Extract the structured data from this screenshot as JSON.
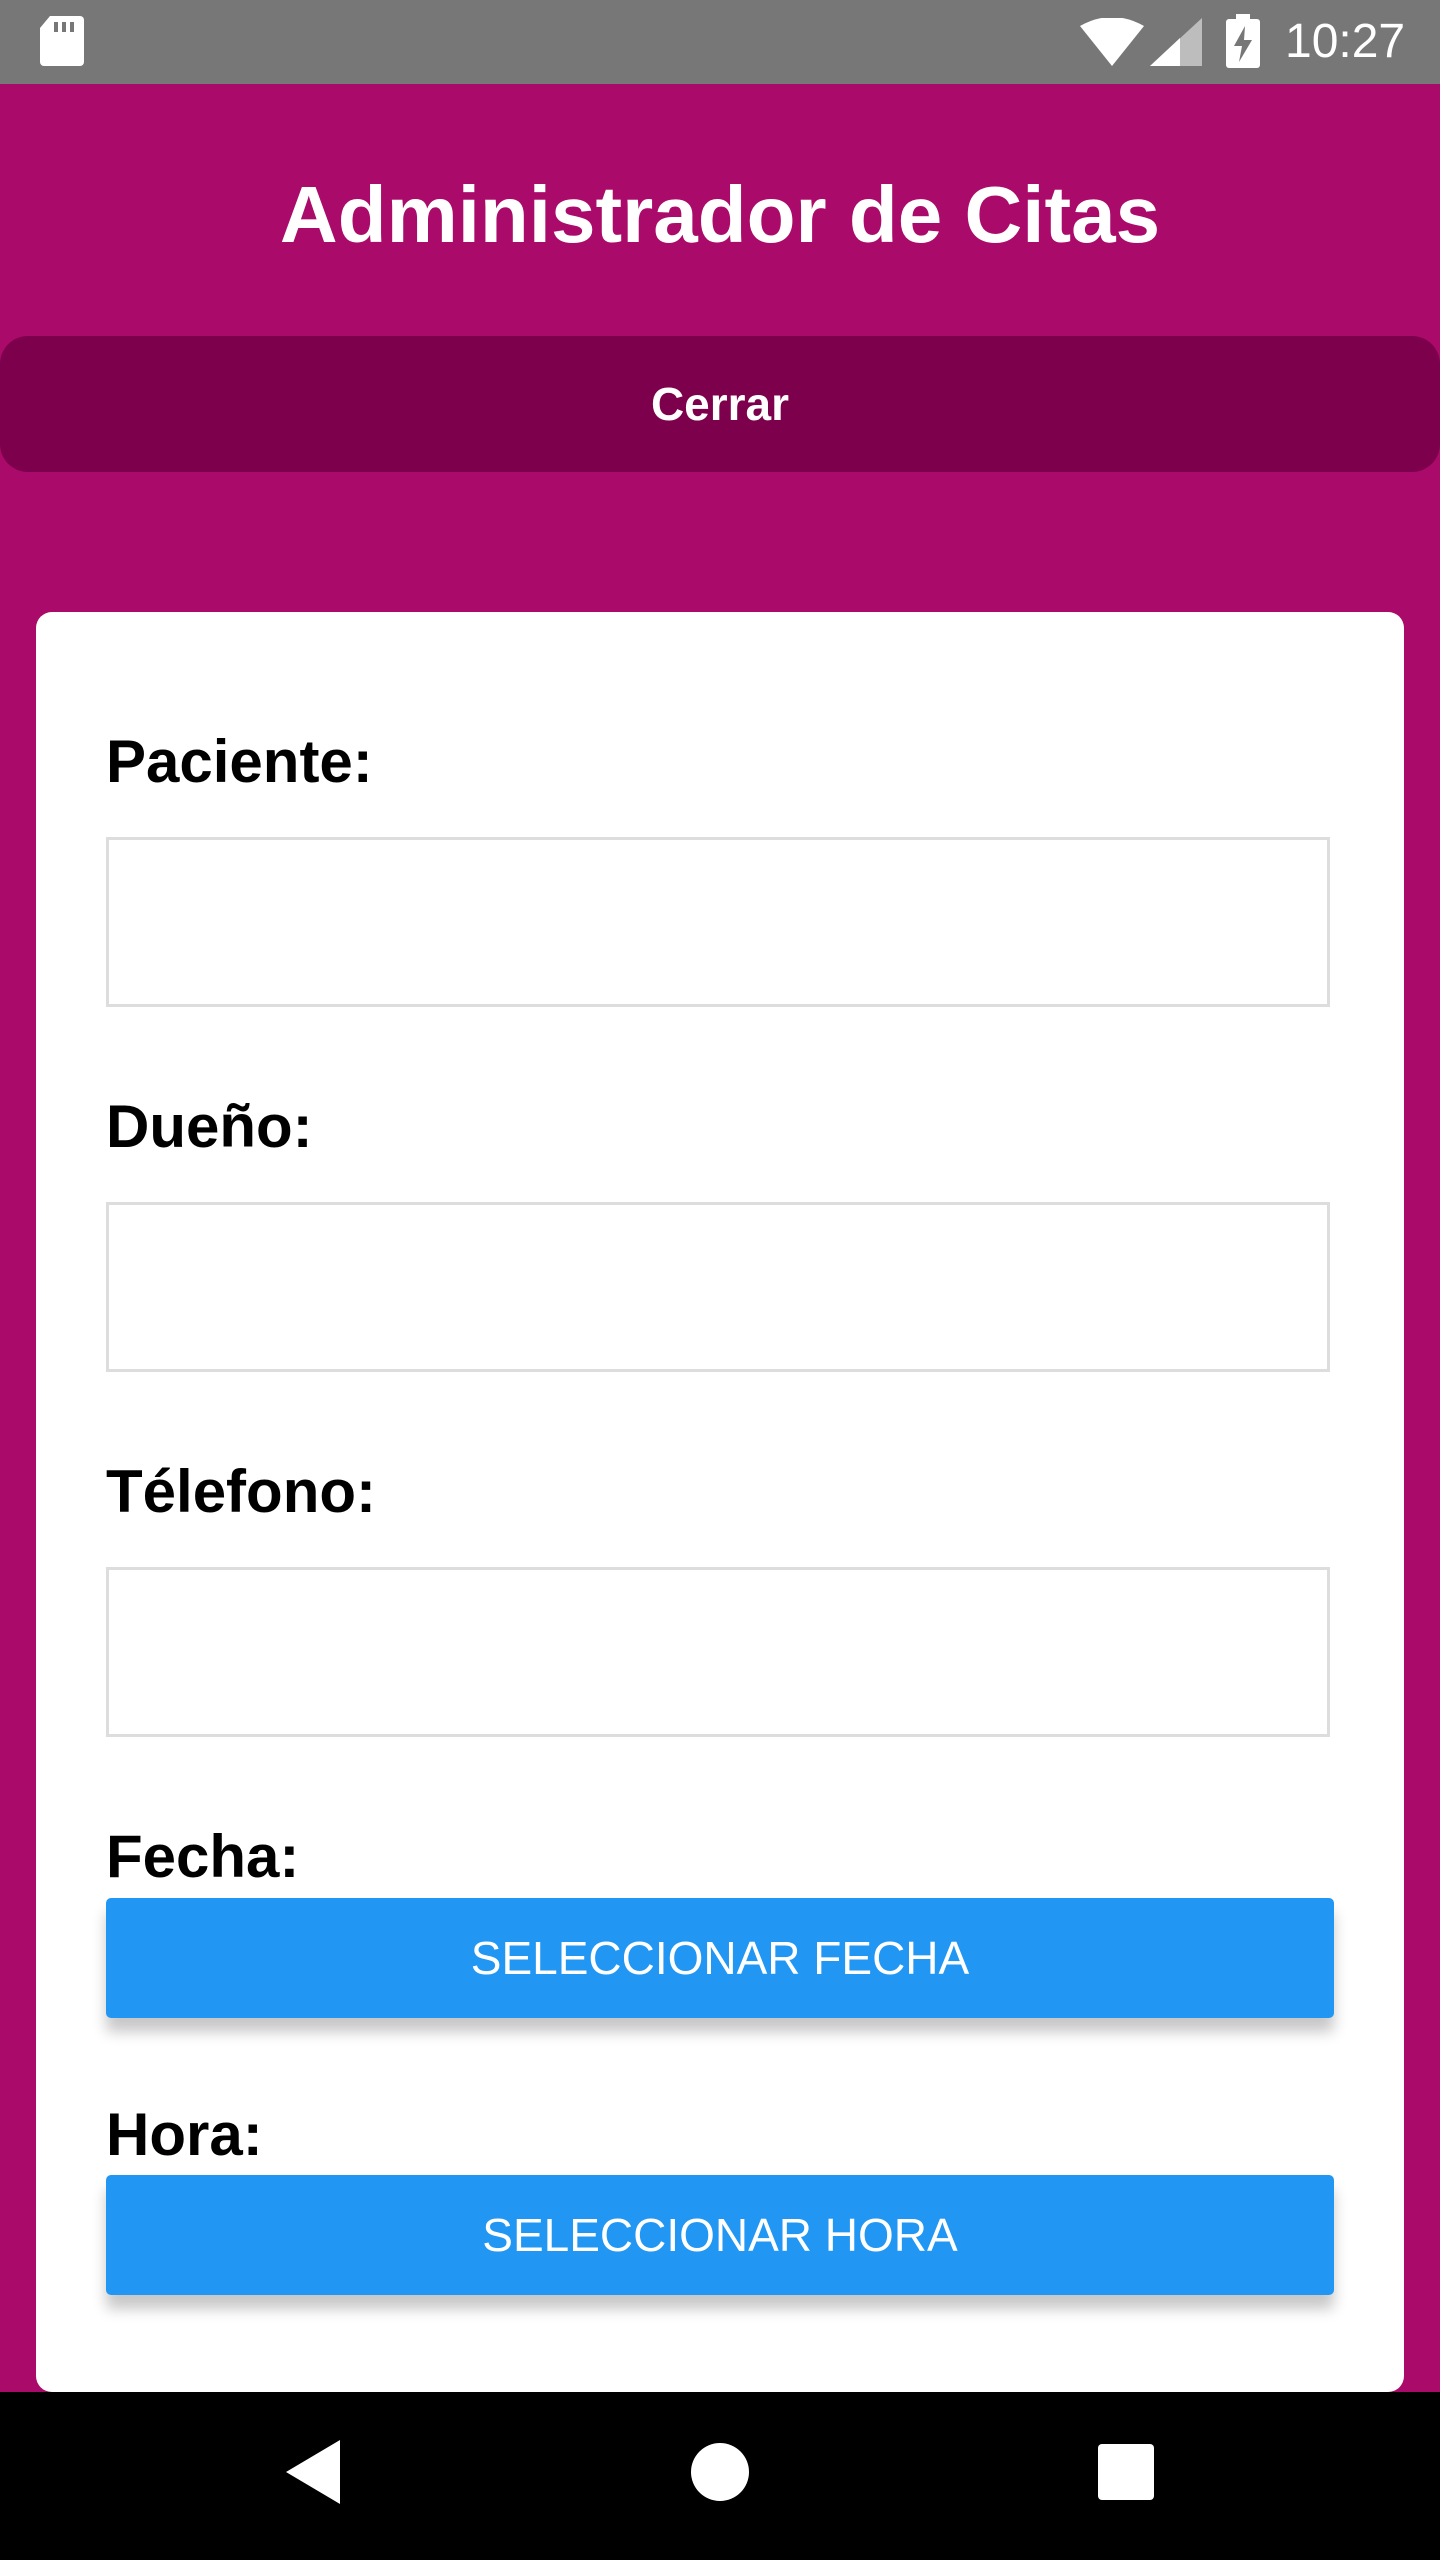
{
  "status_bar": {
    "time": "10:27",
    "icons": [
      "sd-card-icon",
      "wifi-icon",
      "signal-icon",
      "battery-charging-icon"
    ],
    "background": "#777777"
  },
  "header": {
    "title": "Administrador de Citas",
    "close_label": "Cerrar"
  },
  "form": {
    "patient_label": "Paciente:",
    "patient_value": "",
    "owner_label": "Dueño:",
    "owner_value": "",
    "phone_label": "Télefono:",
    "phone_value": "",
    "date_label": "Fecha:",
    "date_button": "SELECCIONAR FECHA",
    "time_label": "Hora:",
    "time_button": "SELECCIONAR HORA"
  },
  "navigation_bar": {
    "icons": [
      "back-icon",
      "home-icon",
      "recents-icon"
    ]
  },
  "colors": {
    "background": "#aa0a69",
    "close_button": "#7c004b",
    "primary_button": "#2196f3",
    "card": "#ffffff"
  }
}
